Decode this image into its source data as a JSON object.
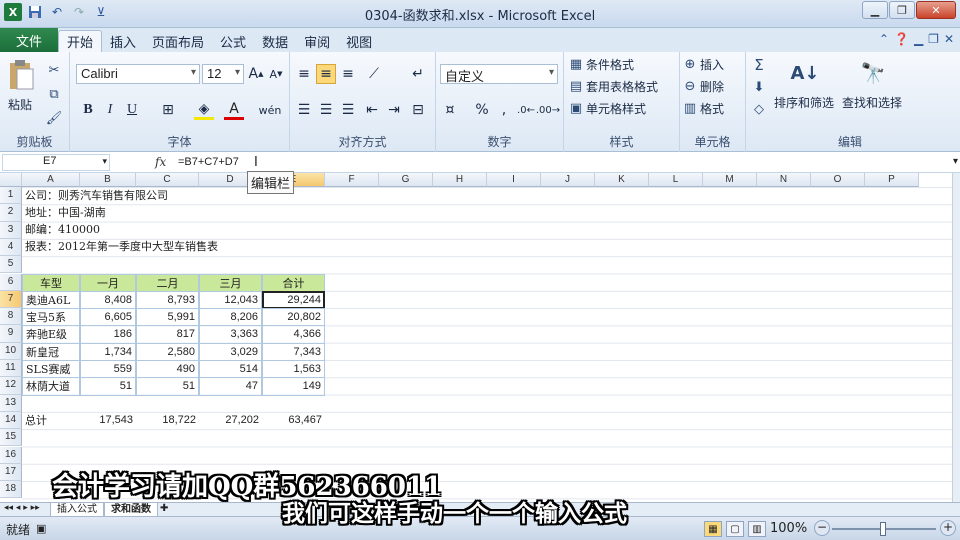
{
  "window": {
    "title": "0304-函数求和.xlsx - Microsoft Excel"
  },
  "tabs": {
    "file": "文件",
    "items": [
      "开始",
      "插入",
      "页面布局",
      "公式",
      "数据",
      "审阅",
      "视图"
    ]
  },
  "ribbon": {
    "clipboard": {
      "label": "剪贴板",
      "paste": "粘贴"
    },
    "font": {
      "label": "字体",
      "name": "Calibri",
      "size": "12",
      "bold": "B",
      "italic": "I",
      "underline": "U"
    },
    "alignment": {
      "label": "对齐方式"
    },
    "number": {
      "label": "数字",
      "format": "自定义",
      "percent": "%"
    },
    "styles": {
      "label": "样式",
      "conditional": "条件格式",
      "table": "套用表格格式",
      "cell_styles": "单元格样式"
    },
    "cells": {
      "label": "单元格",
      "insert": "插入",
      "delete": "删除",
      "format": "格式"
    },
    "editing": {
      "label": "编辑",
      "sort": "排序和筛选",
      "find": "查找和选择"
    }
  },
  "formula_bar": {
    "name_box": "E7",
    "fx": "fx",
    "formula": "=B7+C7+D7",
    "tooltip": "编辑栏"
  },
  "columns": [
    "A",
    "B",
    "C",
    "D",
    "E",
    "F",
    "G",
    "H",
    "I",
    "J",
    "K",
    "L",
    "M",
    "N",
    "O",
    "P"
  ],
  "rows": [
    "1",
    "2",
    "3",
    "4",
    "5",
    "6",
    "7",
    "8",
    "9",
    "10",
    "11",
    "12",
    "13",
    "14",
    "15",
    "16",
    "17",
    "18"
  ],
  "info": {
    "company": "公司：则秀汽车销售有限公司",
    "address": "地址：中国-湖南",
    "zip": "邮编：410000",
    "report": "报表：2012年第一季度中大型车销售表"
  },
  "table": {
    "headers": [
      "车型",
      "一月",
      "二月",
      "三月",
      "合计"
    ],
    "rows": [
      [
        "奥迪A6L",
        "8,408",
        "8,793",
        "12,043",
        "29,244"
      ],
      [
        "宝马5系",
        "6,605",
        "5,991",
        "8,206",
        "20,802"
      ],
      [
        "奔驰E级",
        "186",
        "817",
        "3,363",
        "4,366"
      ],
      [
        "新皇冠",
        "1,734",
        "2,580",
        "3,029",
        "7,343"
      ],
      [
        "SLS赛威",
        "559",
        "490",
        "514",
        "1,563"
      ],
      [
        "林荫大道",
        "51",
        "51",
        "47",
        "149"
      ]
    ],
    "total": [
      "总计",
      "17,543",
      "18,722",
      "27,202",
      "63,467"
    ]
  },
  "sheet_tabs": [
    "插入公式",
    "求和函数"
  ],
  "status": {
    "mode": "就绪",
    "zoom": "100%"
  },
  "captions": {
    "line1": "会计学习请加QQ群562366011",
    "line2": "我们可这样手动一个一个输入公式"
  }
}
